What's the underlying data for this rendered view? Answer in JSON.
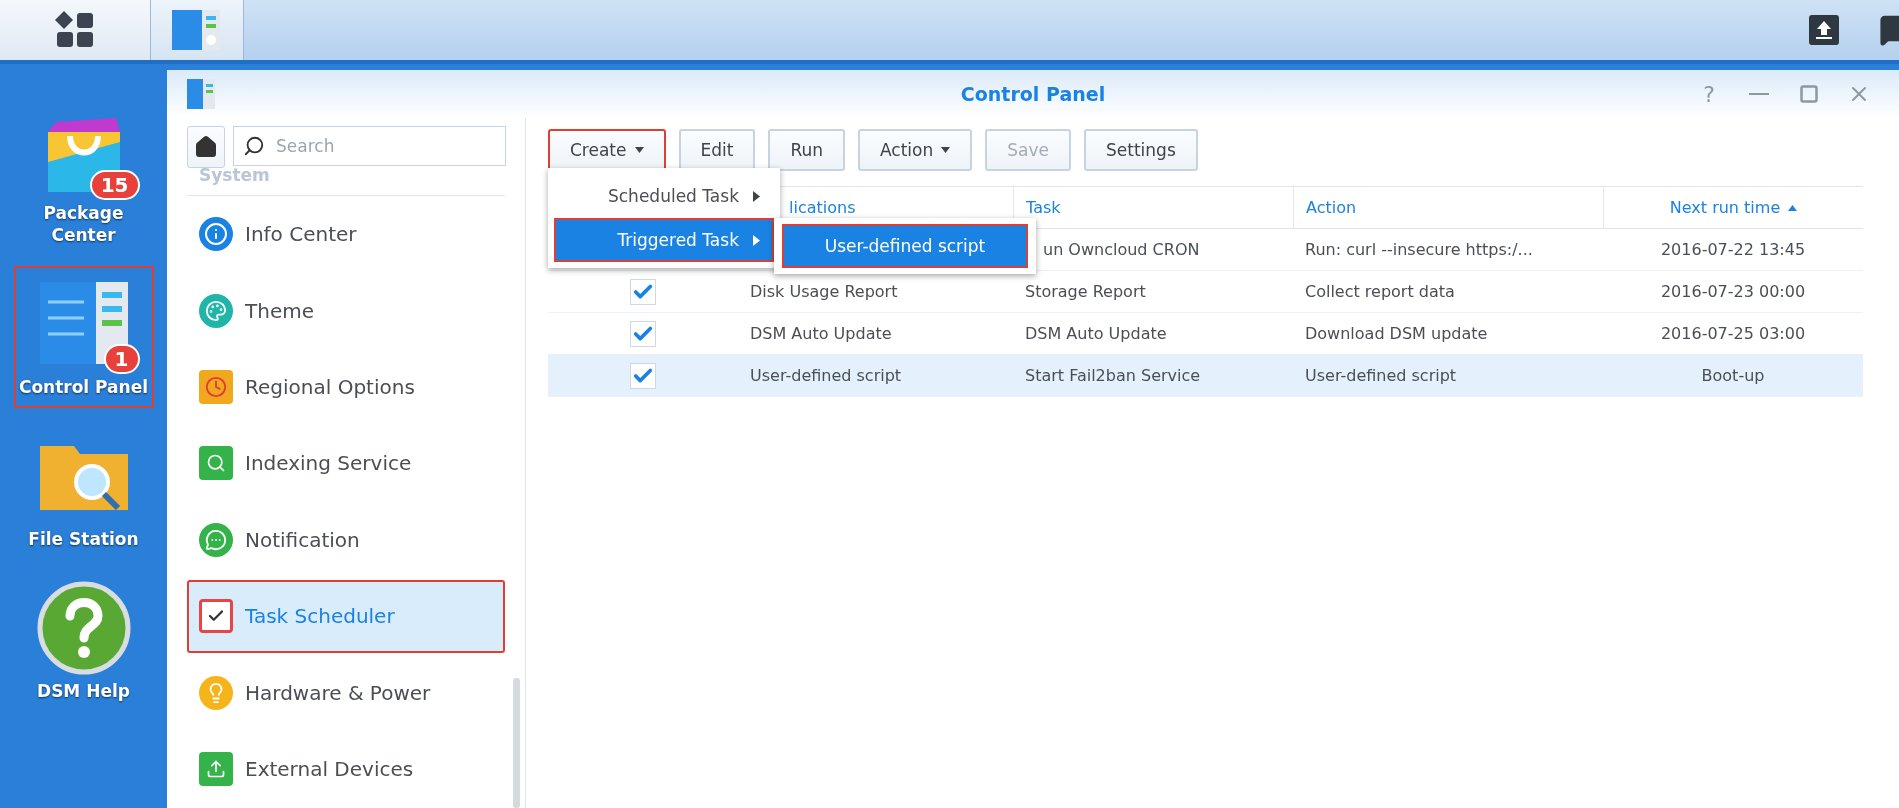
{
  "desktop_icons": [
    {
      "label": "Package Center",
      "badge": "15",
      "annotated": false
    },
    {
      "label": "Control Panel",
      "badge": "1",
      "annotated": true
    },
    {
      "label": "File Station",
      "annotated": false
    },
    {
      "label": "DSM Help",
      "annotated": false
    }
  ],
  "window": {
    "title": "Control Panel",
    "help_label": "?"
  },
  "sidebar": {
    "search": {
      "placeholder": "Search"
    },
    "section": "System",
    "items": [
      {
        "label": "Info Center",
        "selected": false,
        "annotated": false
      },
      {
        "label": "Theme",
        "selected": false,
        "annotated": false
      },
      {
        "label": "Regional Options",
        "selected": false,
        "annotated": false
      },
      {
        "label": "Indexing Service",
        "selected": false,
        "annotated": false
      },
      {
        "label": "Notification",
        "selected": false,
        "annotated": false
      },
      {
        "label": "Task Scheduler",
        "selected": true,
        "annotated": true
      },
      {
        "label": "Hardware & Power",
        "selected": false,
        "annotated": false
      },
      {
        "label": "External Devices",
        "selected": false,
        "annotated": false
      }
    ]
  },
  "toolbar": {
    "buttons": [
      {
        "label": "Create",
        "kind": "dropdown",
        "disabled": false,
        "annotated": true
      },
      {
        "label": "Edit",
        "kind": "plain",
        "disabled": false,
        "annotated": false
      },
      {
        "label": "Run",
        "kind": "plain",
        "disabled": false,
        "annotated": false
      },
      {
        "label": "Action",
        "kind": "dropdown",
        "disabled": false,
        "annotated": false
      },
      {
        "label": "Save",
        "kind": "plain",
        "disabled": true,
        "annotated": false
      },
      {
        "label": "Settings",
        "kind": "plain",
        "disabled": false,
        "annotated": false
      }
    ]
  },
  "create_menu": {
    "items": [
      {
        "label": "Scheduled Task",
        "selected": false,
        "annotated": false
      },
      {
        "label": "Triggered Task",
        "selected": true,
        "annotated": true
      }
    ],
    "submenu": {
      "items": [
        {
          "label": "User-defined script",
          "selected": true,
          "annotated": true
        }
      ]
    }
  },
  "table": {
    "columns": [
      {
        "label": "lications",
        "sorted": false
      },
      {
        "label": "Task",
        "sorted": false
      },
      {
        "label": "Action",
        "sorted": false
      },
      {
        "label": "Next run time",
        "sorted": true
      }
    ],
    "rows": [
      {
        "task": "un Owncloud CRON",
        "action": "Run: curl --insecure https:/...",
        "next_run_time": "2016-07-22 13:45",
        "selected": false
      },
      {
        "checked": true,
        "application": "Disk Usage Report",
        "task": "Storage Report",
        "action": "Collect report data",
        "next_run_time": "2016-07-23 00:00",
        "selected": false
      },
      {
        "checked": true,
        "application": "DSM Auto Update",
        "task": "DSM Auto Update",
        "action": "Download DSM update",
        "next_run_time": "2016-07-25 03:00",
        "selected": false
      },
      {
        "checked": true,
        "application": "User-defined script",
        "task": "Start Fail2ban Service",
        "action": "User-defined script",
        "next_run_time": "Boot-up",
        "selected": true
      }
    ]
  }
}
